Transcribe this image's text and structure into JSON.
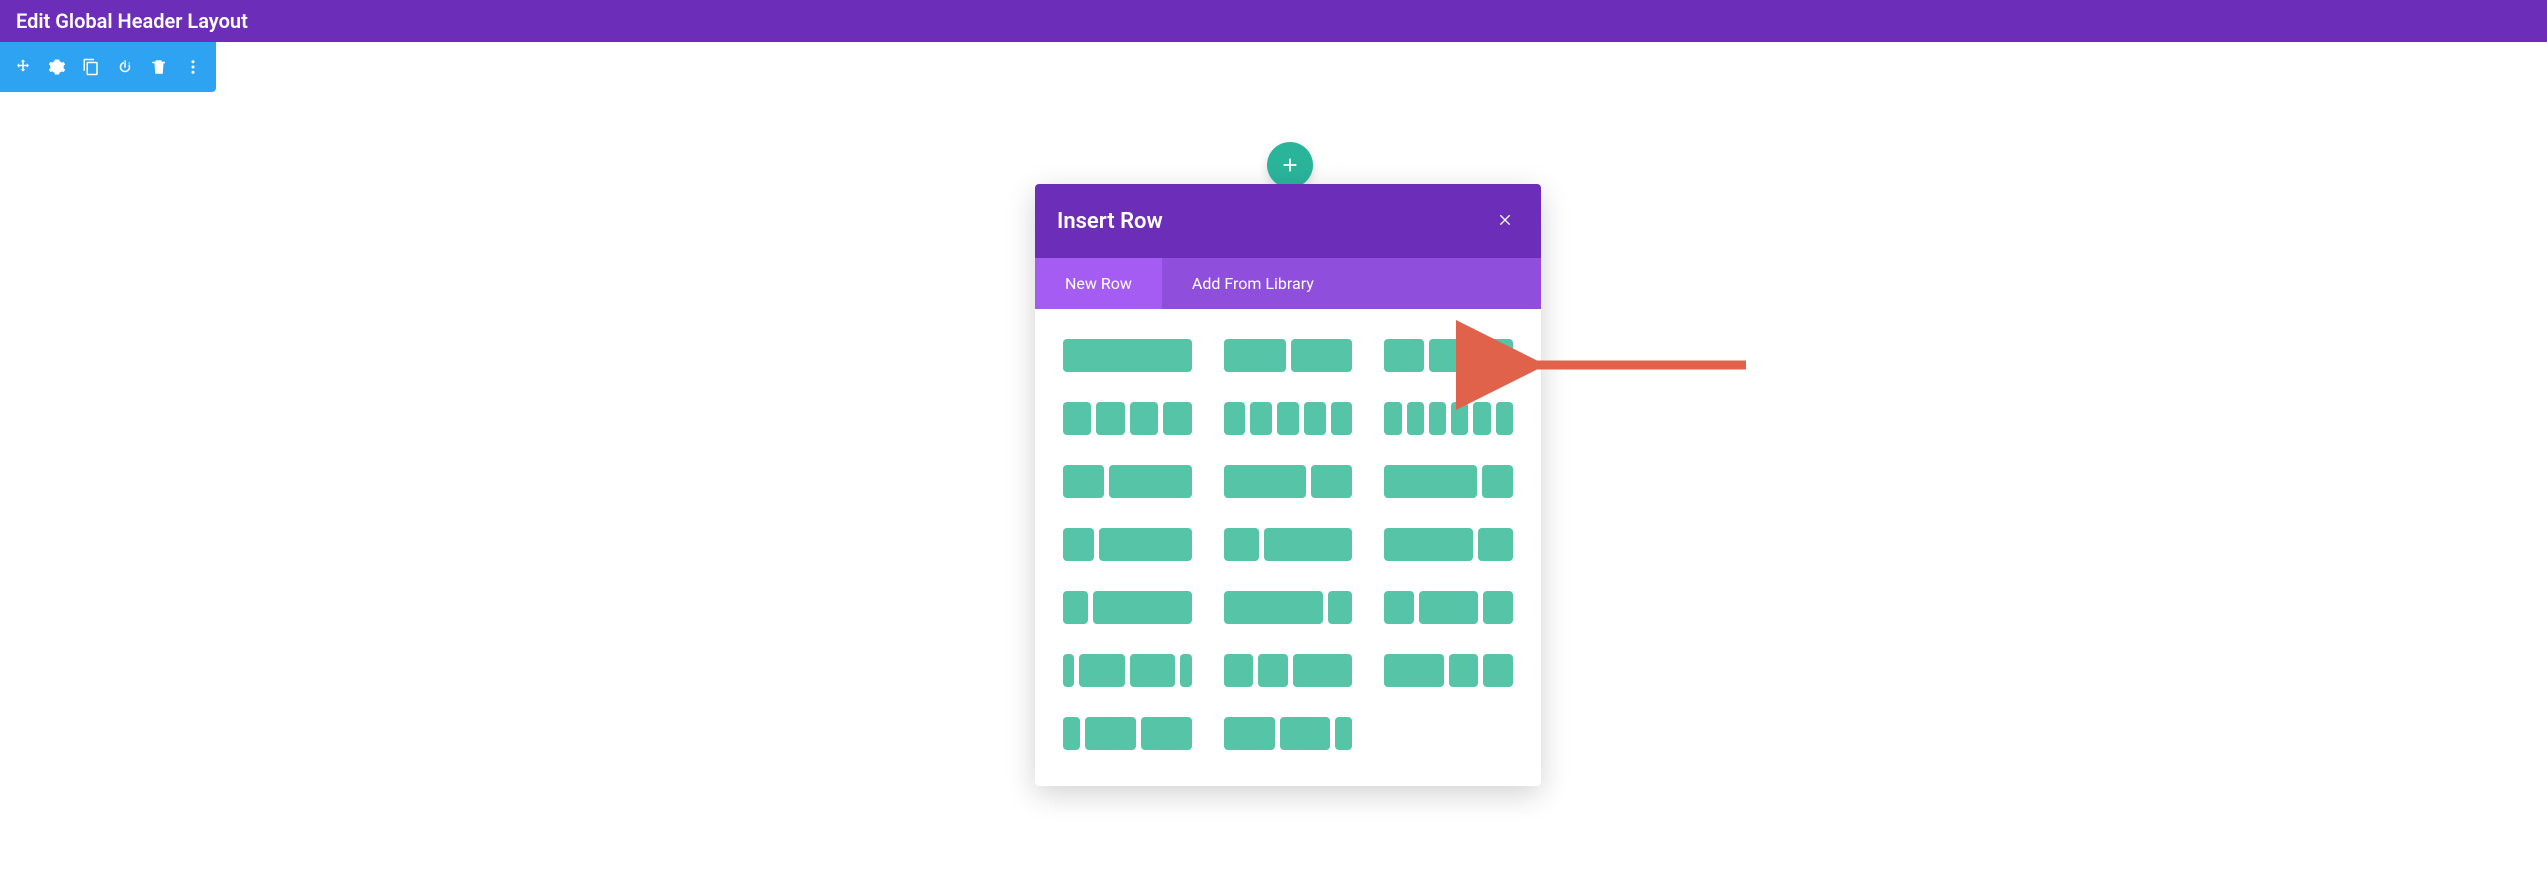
{
  "topbar": {
    "title": "Edit Global Header Layout"
  },
  "modal": {
    "title": "Insert Row",
    "tabs": {
      "new_row": "New Row",
      "add_from_library": "Add From Library"
    },
    "layouts": [
      [
        1
      ],
      [
        1,
        1
      ],
      [
        1,
        1,
        1
      ],
      [
        1,
        1,
        1,
        1
      ],
      [
        1,
        1,
        1,
        1,
        1
      ],
      [
        1,
        1,
        1,
        1,
        1,
        1
      ],
      [
        1,
        2
      ],
      [
        2,
        1
      ],
      [
        3,
        1
      ],
      [
        1,
        3
      ],
      [
        2,
        5
      ],
      [
        5,
        2
      ],
      [
        1,
        4
      ],
      [
        4,
        1
      ],
      [
        1,
        2,
        1
      ],
      [
        1,
        4,
        4,
        1
      ],
      [
        1,
        1,
        2
      ],
      [
        2,
        1,
        1
      ],
      [
        1,
        3,
        3
      ],
      [
        3,
        3,
        1
      ]
    ]
  }
}
